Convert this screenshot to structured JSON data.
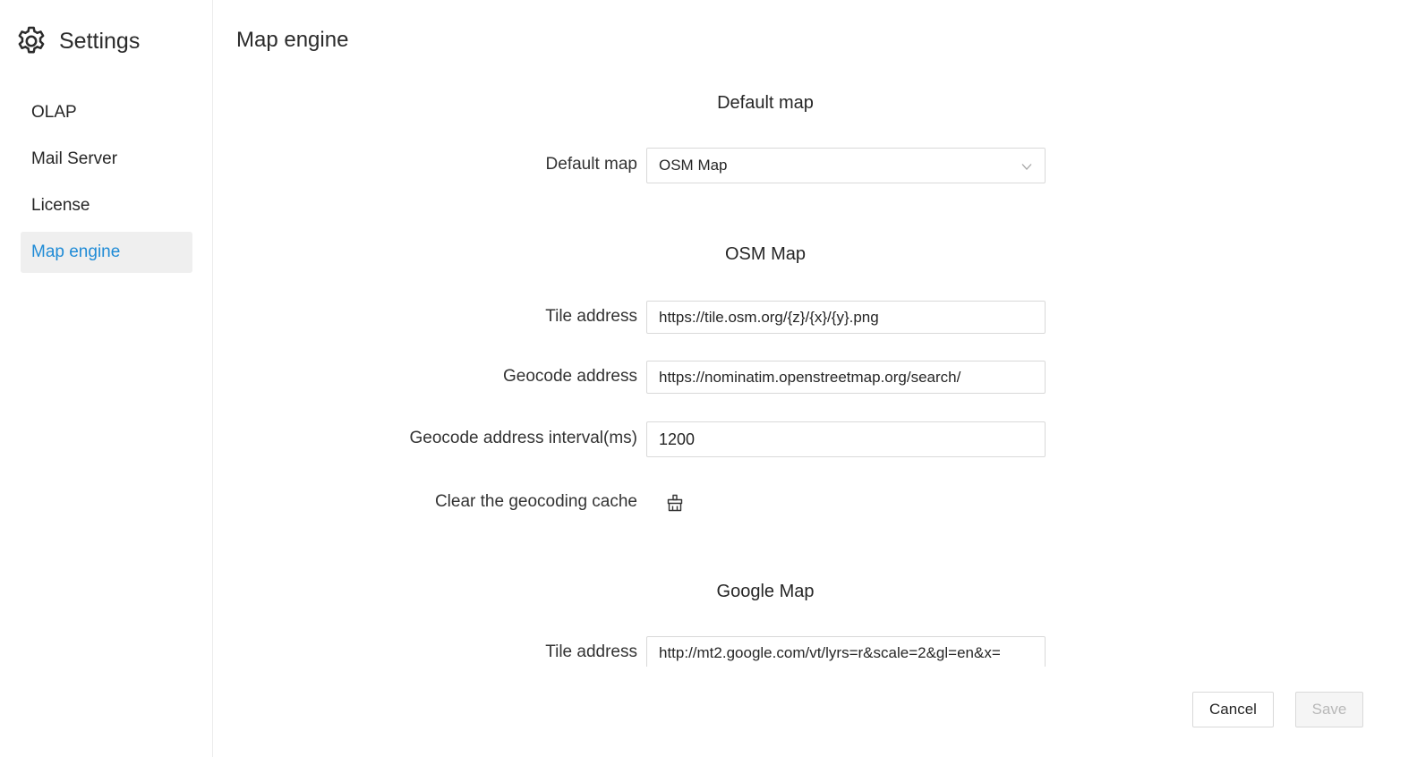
{
  "sidebar": {
    "title": "Settings",
    "icon": "gear-icon",
    "items": [
      {
        "label": "OLAP",
        "active": false
      },
      {
        "label": "Mail Server",
        "active": false
      },
      {
        "label": "License",
        "active": false
      },
      {
        "label": "Map engine",
        "active": true
      }
    ]
  },
  "main": {
    "title": "Map engine",
    "default_section": {
      "title": "Default map",
      "default_map_label": "Default map",
      "default_map_value": "OSM Map"
    },
    "osm_section": {
      "title": "OSM Map",
      "tile_label": "Tile address",
      "tile_value": "https://tile.osm.org/{z}/{x}/{y}.png",
      "geocode_label": "Geocode address",
      "geocode_value": "https://nominatim.openstreetmap.org/search/",
      "interval_label": "Geocode address interval(ms)",
      "interval_value": "1200",
      "clear_cache_label": "Clear the geocoding cache",
      "clear_cache_icon": "broom-icon"
    },
    "google_section": {
      "title": "Google Map",
      "tile_label": "Tile address",
      "tile_value": "http://mt2.google.com/vt/lyrs=r&scale=2&gl=en&x="
    }
  },
  "footer": {
    "cancel_label": "Cancel",
    "save_label": "Save"
  },
  "colors": {
    "accent": "#1f8bd6",
    "active_bg": "#efefef",
    "border": "#d9d9d9",
    "disabled_text": "#b8b8b8"
  }
}
